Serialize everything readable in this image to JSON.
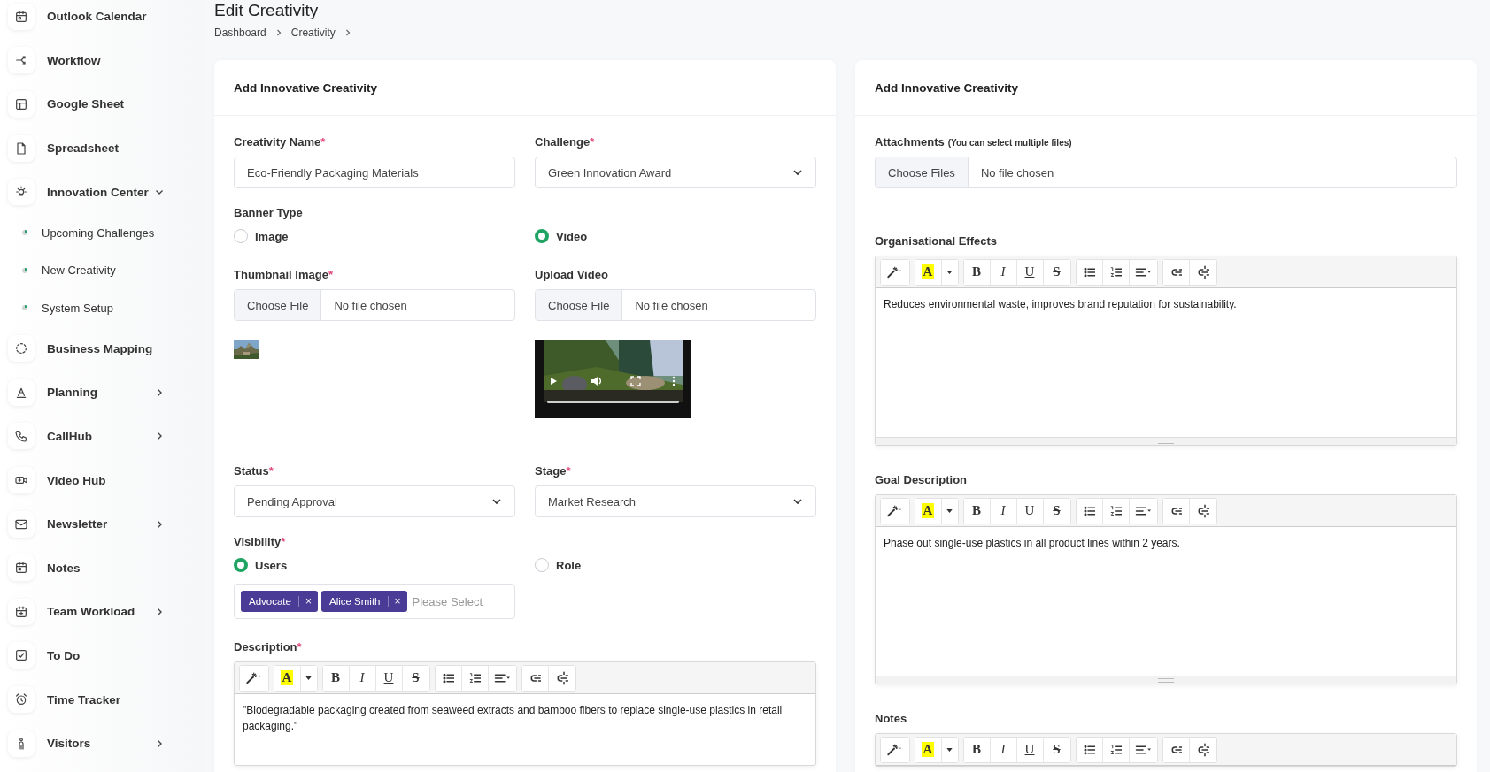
{
  "sidebar": {
    "items": [
      {
        "label": "Outlook Calendar"
      },
      {
        "label": "Workflow"
      },
      {
        "label": "Google Sheet"
      },
      {
        "label": "Spreadsheet"
      },
      {
        "label": "Innovation Center",
        "expanded": true,
        "children": [
          {
            "label": "Upcoming Challenges"
          },
          {
            "label": "New Creativity"
          },
          {
            "label": "System Setup"
          }
        ]
      },
      {
        "label": "Business Mapping"
      },
      {
        "label": "Planning",
        "expanded": false
      },
      {
        "label": "CallHub",
        "expanded": false
      },
      {
        "label": "Video Hub"
      },
      {
        "label": "Newsletter",
        "expanded": false
      },
      {
        "label": "Notes"
      },
      {
        "label": "Team Workload",
        "expanded": false
      },
      {
        "label": "To Do"
      },
      {
        "label": "Time Tracker"
      },
      {
        "label": "Visitors",
        "expanded": false
      }
    ]
  },
  "page": {
    "title": "Edit Creativity",
    "breadcrumb": [
      "Dashboard",
      "Creativity"
    ]
  },
  "left_card": {
    "title": "Add Innovative Creativity",
    "creativity_name": {
      "label": "Creativity Name",
      "required_mark": "*",
      "value": "Eco-Friendly Packaging Materials"
    },
    "challenge": {
      "label": "Challenge",
      "required_mark": "*",
      "value": "Green Innovation Award"
    },
    "banner_type": {
      "label": "Banner Type",
      "options": [
        {
          "label": "Image",
          "selected": false
        },
        {
          "label": "Video",
          "selected": true
        }
      ]
    },
    "thumbnail_image": {
      "label": "Thumbnail Image",
      "required_mark": "*",
      "button": "Choose File",
      "status": "No file chosen"
    },
    "upload_video": {
      "label": "Upload Video",
      "button": "Choose File",
      "status": "No file chosen",
      "progress": {
        "level": 0
      }
    },
    "status": {
      "label": "Status",
      "required_mark": "*",
      "value": "Pending Approval"
    },
    "stage": {
      "label": "Stage",
      "required_mark": "*",
      "value": "Market Research"
    },
    "visibility": {
      "label": "Visibility",
      "required_mark": "*",
      "options": [
        {
          "label": "Users",
          "selected": true
        },
        {
          "label": "Role",
          "selected": false
        }
      ],
      "tags": [
        {
          "label": "Advocate",
          "remove": "×"
        },
        {
          "label": "Alice Smith",
          "remove": "×"
        }
      ],
      "placeholder": "Please Select"
    },
    "description": {
      "label": "Description",
      "required_mark": "*",
      "toolbar": [
        [
          {
            "kind": "magic"
          }
        ],
        [
          {
            "kind": "color",
            "glyph": "A"
          },
          {
            "kind": "caret"
          }
        ],
        [
          {
            "kind": "bold",
            "glyph": "B"
          },
          {
            "kind": "italic",
            "glyph": "I"
          },
          {
            "kind": "underline",
            "glyph": "U"
          },
          {
            "kind": "strike",
            "glyph": "S"
          }
        ],
        [
          {
            "kind": "ul"
          },
          {
            "kind": "ol"
          },
          {
            "kind": "align"
          }
        ],
        [
          {
            "kind": "link"
          },
          {
            "kind": "unlink"
          }
        ]
      ],
      "content": "\"Biodegradable packaging created from seaweed extracts and bamboo fibers to replace single-use plastics in retail packaging.\""
    }
  },
  "right_card": {
    "title": "Add Innovative Creativity",
    "attachments": {
      "label": "Attachments",
      "hint": "(You can select multiple files)",
      "button": "Choose Files",
      "status": "No file chosen"
    },
    "editors": [
      {
        "label": "Organisational Effects",
        "toolbar": [
          [
            {
              "kind": "magic"
            }
          ],
          [
            {
              "kind": "color",
              "glyph": "A"
            },
            {
              "kind": "caret"
            }
          ],
          [
            {
              "kind": "bold",
              "glyph": "B"
            },
            {
              "kind": "italic",
              "glyph": "I"
            },
            {
              "kind": "underline",
              "glyph": "U"
            },
            {
              "kind": "strike",
              "glyph": "S"
            }
          ],
          [
            {
              "kind": "ul"
            },
            {
              "kind": "ol"
            },
            {
              "kind": "align"
            }
          ],
          [
            {
              "kind": "link"
            },
            {
              "kind": "unlink"
            }
          ]
        ],
        "content": "Reduces environmental waste, improves brand reputation for sustainability."
      },
      {
        "label": "Goal Description",
        "toolbar": [
          [
            {
              "kind": "magic"
            }
          ],
          [
            {
              "kind": "color",
              "glyph": "A"
            },
            {
              "kind": "caret"
            }
          ],
          [
            {
              "kind": "bold",
              "glyph": "B"
            },
            {
              "kind": "italic",
              "glyph": "I"
            },
            {
              "kind": "underline",
              "glyph": "U"
            },
            {
              "kind": "strike",
              "glyph": "S"
            }
          ],
          [
            {
              "kind": "ul"
            },
            {
              "kind": "ol"
            },
            {
              "kind": "align"
            }
          ],
          [
            {
              "kind": "link"
            },
            {
              "kind": "unlink"
            }
          ]
        ],
        "content": "Phase out single-use plastics in all product lines within 2 years."
      },
      {
        "label": "Notes",
        "toolbar": [
          [
            {
              "kind": "magic"
            }
          ],
          [
            {
              "kind": "color",
              "glyph": "A"
            },
            {
              "kind": "caret"
            }
          ],
          [
            {
              "kind": "bold",
              "glyph": "B"
            },
            {
              "kind": "italic",
              "glyph": "I"
            },
            {
              "kind": "underline",
              "glyph": "U"
            },
            {
              "kind": "strike",
              "glyph": "S"
            }
          ],
          [
            {
              "kind": "ul"
            },
            {
              "kind": "ol"
            },
            {
              "kind": "align"
            }
          ],
          [
            {
              "kind": "link"
            },
            {
              "kind": "unlink"
            }
          ]
        ]
      }
    ]
  }
}
